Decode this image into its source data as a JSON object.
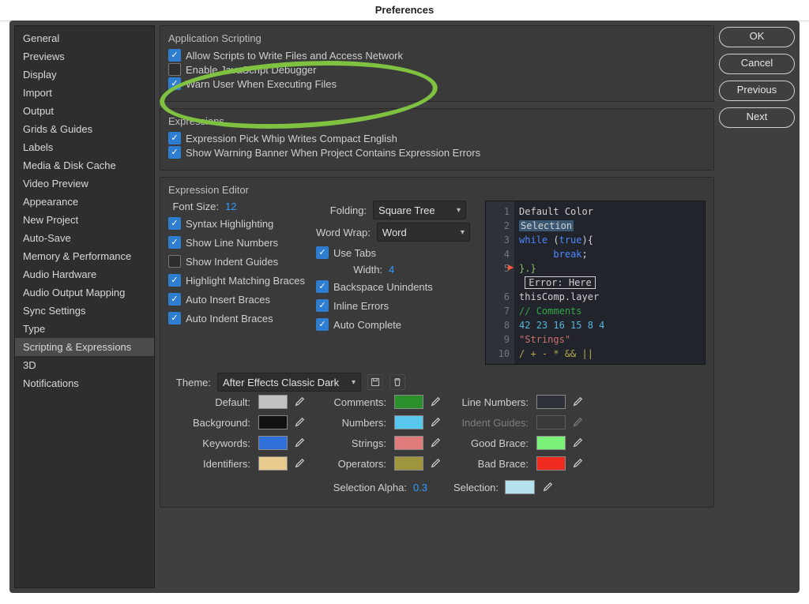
{
  "window": {
    "title": "Preferences"
  },
  "buttons": {
    "ok": "OK",
    "cancel": "Cancel",
    "previous": "Previous",
    "next": "Next"
  },
  "sidebar": {
    "items": [
      "General",
      "Previews",
      "Display",
      "Import",
      "Output",
      "Grids & Guides",
      "Labels",
      "Media & Disk Cache",
      "Video Preview",
      "Appearance",
      "New Project",
      "Auto-Save",
      "Memory & Performance",
      "Audio Hardware",
      "Audio Output Mapping",
      "Sync Settings",
      "Type",
      "Scripting & Expressions",
      "3D",
      "Notifications"
    ],
    "selected": "Scripting & Expressions"
  },
  "panels": {
    "appscript": {
      "title": "Application Scripting",
      "opts": [
        "Allow Scripts to Write Files and Access Network",
        "Enable JavaScript Debugger",
        "Warn User When Executing Files"
      ],
      "checked": [
        true,
        false,
        true
      ]
    },
    "expressions": {
      "title": "Expressions",
      "opts": [
        "Expression Pick Whip Writes Compact English",
        "Show Warning Banner When Project Contains Expression Errors"
      ],
      "checked": [
        true,
        true
      ]
    },
    "editor": {
      "title": "Expression Editor",
      "left": {
        "fontsize_label": "Font Size:",
        "fontsize": "12",
        "opts": [
          "Syntax Highlighting",
          "Show Line Numbers",
          "Show Indent Guides",
          "Highlight Matching Braces",
          "Auto Insert Braces",
          "Auto Indent Braces"
        ],
        "checked": [
          true,
          true,
          false,
          true,
          true,
          true
        ]
      },
      "mid": {
        "folding_label": "Folding:",
        "folding": "Square Tree",
        "wordwrap_label": "Word Wrap:",
        "wordwrap": "Word",
        "opts": [
          "Use Tabs",
          "Backspace Unindents",
          "Inline Errors",
          "Auto Complete"
        ],
        "checked": [
          true,
          true,
          true,
          true
        ],
        "width_label": "Width:",
        "width": "4"
      }
    },
    "theme": {
      "theme_label": "Theme:",
      "theme": "After Effects Classic Dark",
      "rows": [
        {
          "a": "Default:",
          "ac": "background:#c2c2c2",
          "b": "Comments:",
          "bc": "background:#2b8f2b",
          "c": "Line Numbers:",
          "cc": "background:#2e3238"
        },
        {
          "a": "Background:",
          "ac": "background:#111",
          "b": "Numbers:",
          "bc": "background:#57c7ee",
          "c": "Indent Guides:",
          "cc": "background:#3a3a3a"
        },
        {
          "a": "Keywords:",
          "ac": "background:#2f6fd8",
          "b": "Strings:",
          "bc": "background:#e07b7b",
          "c": "Good Brace:",
          "cc": "background:#7af27a"
        },
        {
          "a": "Identifiers:",
          "ac": "background:#e8c98e",
          "b": "Operators:",
          "bc": "background:#9f953c",
          "c": "Bad Brace:",
          "cc": "background:#ef2b1f"
        }
      ],
      "sel_alpha_label": "Selection Alpha:",
      "sel_alpha": "0.3",
      "sel_label": "Selection:",
      "sel_color": "background:#b6e2f0"
    }
  },
  "preview": {
    "l1": "Default Color",
    "l2": "Selection",
    "l5": "}.}",
    "err": "Error: Here",
    "l6a": "thisComp",
    "l6b": "layer",
    "l7": "// Comments",
    "l8": "42 23 16 15 8 4",
    "l9": "\"Strings\"",
    "l10": "/ + - * && ||"
  }
}
